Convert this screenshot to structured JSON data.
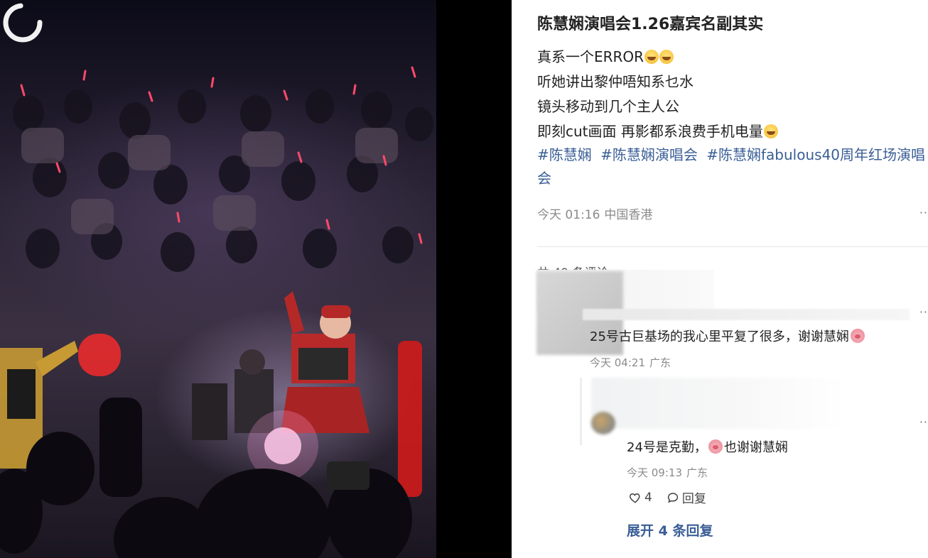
{
  "post": {
    "title": "陈慧娴演唱会1.26嘉宾名副其实",
    "lines": [
      "真系一个ERROR",
      "听她讲出黎仲唔知系乜水",
      "镜头移动到几个主人公",
      "即刻cut画面 再影都系浪费手机电量"
    ],
    "hashtags": [
      "#陈慧娴",
      "#陈慧娴演唱会",
      "#陈慧娴fabulous40周年红场演唱会"
    ],
    "time": "今天 01:16",
    "location": "中国香港",
    "more": "··"
  },
  "comments": {
    "count_label": "共 49 条评论",
    "items": [
      {
        "text": "25号古巨基场的我心里平复了很多，谢谢慧娴",
        "time": "今天 04:21",
        "location": "广东",
        "more": "··",
        "reply": {
          "text_prefix": "24号是克勤，",
          "text_suffix": "也谢谢慧娴",
          "time": "今天 09:13",
          "location": "广东",
          "more": "··",
          "likes": "4",
          "reply_label": "回复"
        },
        "expand_label": "展开 4 条回复"
      }
    ]
  },
  "icons": {
    "emoji_grin": "grinning-sweat-emoji",
    "emoji_pig": "pig-face-emoji",
    "like": "heart-icon",
    "reply": "comment-bubble-icon",
    "loading": "loading-spinner-icon"
  },
  "colors": {
    "hashtag": "#3a5e96",
    "meta": "#8a8a8a",
    "text": "#222222"
  }
}
